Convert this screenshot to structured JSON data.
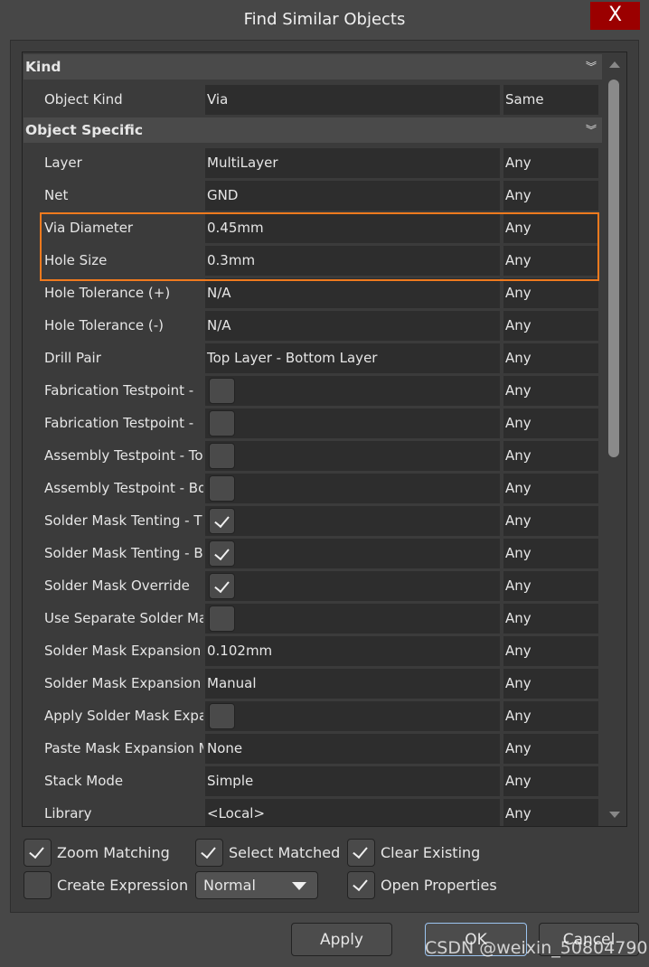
{
  "window": {
    "title": "Find Similar Objects",
    "close": "X"
  },
  "sections": [
    {
      "title": "Kind"
    },
    {
      "title": "Object Specific"
    }
  ],
  "kind_row": {
    "label": "Object Kind",
    "value": "Via",
    "compare": "Same"
  },
  "rows": [
    {
      "label": "Layer",
      "value": "MultiLayer",
      "compare": "Any"
    },
    {
      "label": "Net",
      "value": "GND",
      "compare": "Any"
    },
    {
      "label": "Via Diameter",
      "value": "0.45mm",
      "compare": "Any"
    },
    {
      "label": "Hole Size",
      "value": "0.3mm",
      "compare": "Any"
    },
    {
      "label": "Hole Tolerance (+)",
      "value": "N/A",
      "compare": "Any"
    },
    {
      "label": "Hole Tolerance (-)",
      "value": "N/A",
      "compare": "Any"
    },
    {
      "label": "Drill Pair",
      "value": "Top Layer - Bottom Layer",
      "compare": "Any"
    },
    {
      "label": "Fabrication Testpoint - ",
      "checkbox": false,
      "compare": "Any"
    },
    {
      "label": "Fabrication Testpoint - ",
      "checkbox": false,
      "compare": "Any"
    },
    {
      "label": "Assembly Testpoint - To",
      "checkbox": false,
      "compare": "Any"
    },
    {
      "label": "Assembly Testpoint - Bo",
      "checkbox": false,
      "compare": "Any"
    },
    {
      "label": "Solder Mask Tenting - T",
      "checkbox": true,
      "compare": "Any"
    },
    {
      "label": "Solder Mask Tenting - B",
      "checkbox": true,
      "compare": "Any"
    },
    {
      "label": "Solder Mask Override",
      "checkbox": true,
      "compare": "Any"
    },
    {
      "label": "Use Separate Solder Mask",
      "checkbox": false,
      "compare": "Any"
    },
    {
      "label": "Solder Mask Expansion",
      "value": "0.102mm",
      "compare": "Any"
    },
    {
      "label": "Solder Mask Expansion",
      "value": "Manual",
      "compare": "Any"
    },
    {
      "label": "Apply Solder Mask Expansion",
      "checkbox": false,
      "compare": "Any"
    },
    {
      "label": "Paste Mask Expansion Mode",
      "value": "None",
      "compare": "Any"
    },
    {
      "label": "Stack Mode",
      "value": "Simple",
      "compare": "Any"
    },
    {
      "label": "Library",
      "value": "<Local>",
      "compare": "Any"
    }
  ],
  "options": {
    "zoom_matching": {
      "label": "Zoom Matching",
      "checked": true
    },
    "select_matched": {
      "label": "Select Matched",
      "checked": true
    },
    "clear_existing": {
      "label": "Clear Existing",
      "checked": true
    },
    "create_expression": {
      "label": "Create Expression",
      "checked": false
    },
    "mode": "Normal",
    "open_properties": {
      "label": "Open Properties",
      "checked": true
    }
  },
  "buttons": {
    "apply": "Apply",
    "ok": "OK",
    "cancel": "Cancel"
  },
  "watermark": "CSDN @weixin_50804790",
  "colors": {
    "highlight": "#f07a1e",
    "close": "#9b0000"
  }
}
